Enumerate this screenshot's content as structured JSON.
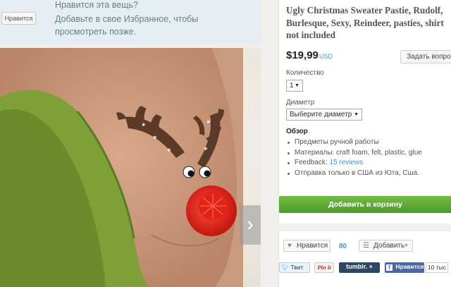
{
  "favorite": {
    "button_label": "Нравится",
    "title": "Нравится эта вещь?",
    "text": "Добавьте в свое Избранное, чтобы просмотреть позже."
  },
  "product": {
    "title": "Ugly Christmas Sweater Pastie, Rudolf, Burlesque, Sexy, Reindeer, pasties, shirt not included",
    "price": "$19,99",
    "currency": "USD",
    "ask_button": "Задать вопрос",
    "quantity_label": "Количество",
    "quantity_value": "1",
    "diameter_label": "Диаметр",
    "diameter_value": "Выберите диаметр",
    "overview_title": "Обзор",
    "features": [
      "Предметы ручной работы",
      "Материалы: craft foam, felt, plastic, glue",
      "Feedback: ",
      "Отправка только в США из Юта, Сша."
    ],
    "feedback_link": "15 reviews",
    "add_to_cart": "Добавить в корзину"
  },
  "social": {
    "like_label": "Нравится",
    "like_count": "80",
    "add_label": "Добавить",
    "tweet": "Твит",
    "pinit": "Pin it",
    "tumblr": "tumblr. +",
    "fb_like": "Нравится",
    "fb_count": "10 тыс"
  },
  "gallery": {
    "next_arrow": "›"
  },
  "colors": {
    "banner_bg": "#e4eef3",
    "cart_green": "#5ea836",
    "link_blue": "#4a90c0",
    "tumblr": "#2c4762",
    "facebook": "#4c66a4"
  }
}
